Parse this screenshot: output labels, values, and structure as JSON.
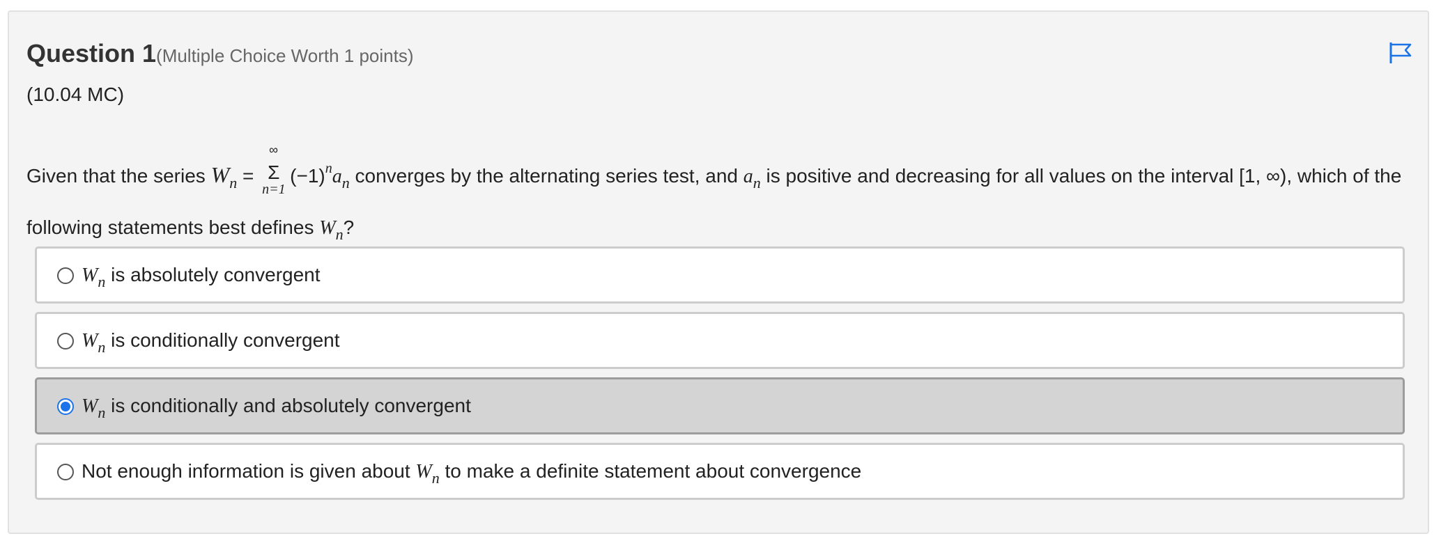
{
  "question": {
    "title": "Question 1",
    "subtitle": "(Multiple Choice Worth 1 points)",
    "code": "(10.04 MC)",
    "flag_icon": "flag-icon",
    "accent_color": "#1a73e8",
    "stem": {
      "part1": "Given that the series",
      "W": "W",
      "n": "n",
      "equals": "=",
      "sigma": "Σ",
      "sigma_upper": "∞",
      "sigma_lower": "n=1",
      "factor": "(−1)",
      "factor_exp": "n",
      "a": "a",
      "part2": "converges by the alternating series test, and",
      "part3": "is positive and decreasing for all values on the interval [1, ∞), which of the following statements best defines",
      "end": "?"
    }
  },
  "options": [
    {
      "W": "W",
      "n": "n",
      "text": "is absolutely convergent",
      "selected": false
    },
    {
      "W": "W",
      "n": "n",
      "text": "is conditionally convergent",
      "selected": false
    },
    {
      "W": "W",
      "n": "n",
      "text": "is conditionally and absolutely convergent",
      "selected": true
    },
    {
      "pre": "Not enough information is given about",
      "W": "W",
      "n": "n",
      "post": "to make a definite statement about convergence",
      "selected": false
    }
  ]
}
